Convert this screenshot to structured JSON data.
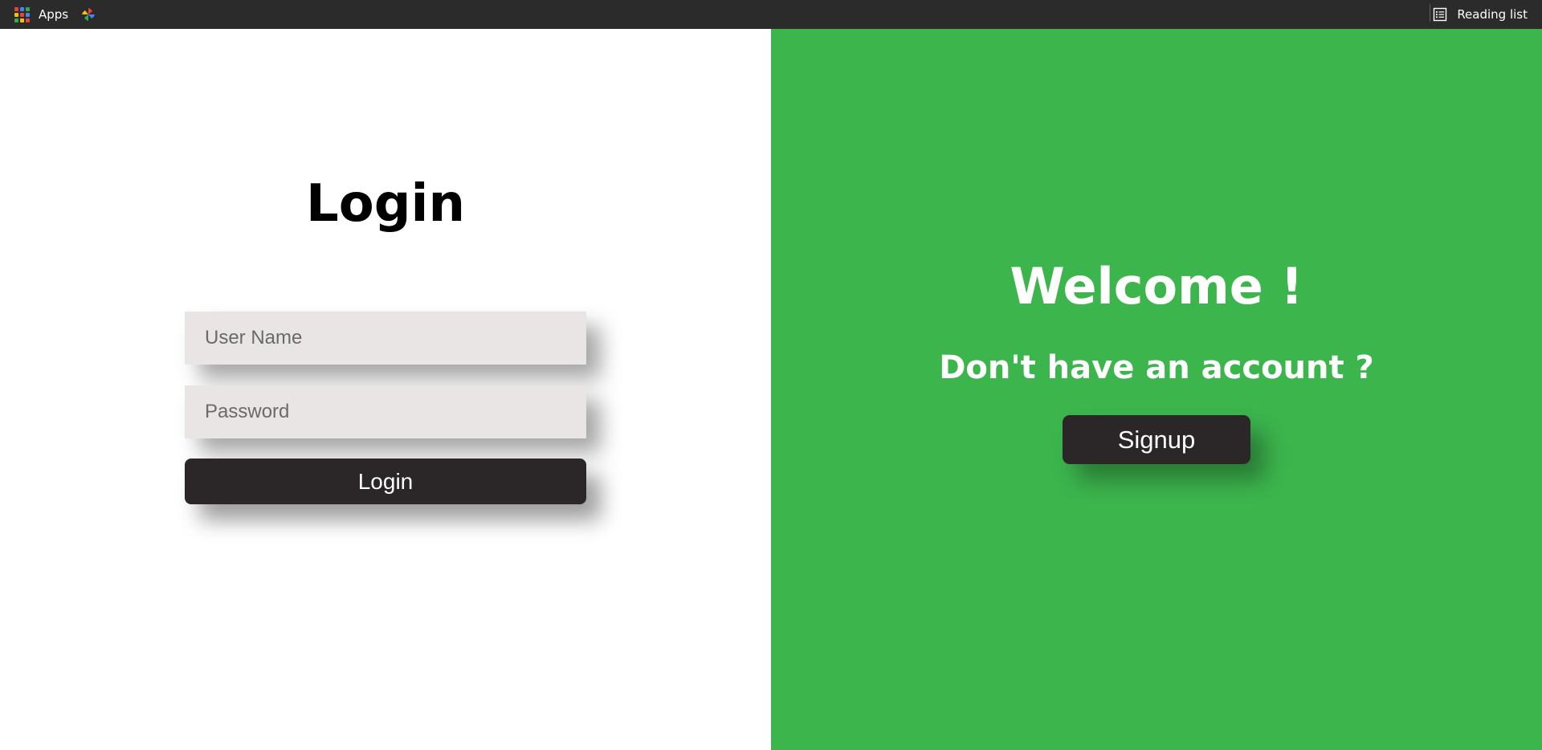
{
  "bookmarks_bar": {
    "apps_label": "Apps",
    "reading_list_label": "Reading list"
  },
  "login_panel": {
    "title": "Login",
    "username_placeholder": "User Name",
    "password_placeholder": "Password",
    "login_button_label": "Login"
  },
  "signup_panel": {
    "welcome_title": "Welcome !",
    "account_prompt": "Don't have an account ?",
    "signup_button_label": "Signup"
  },
  "colors": {
    "bookmarks_bar_bg": "#2b2b2b",
    "accent_green": "#3cb54d",
    "input_bg": "#e9e5e4",
    "button_dark": "#2b2627",
    "apps_grid": [
      "#ea4335",
      "#4285f4",
      "#34a853",
      "#fbbc05",
      "#ea4335",
      "#4285f4",
      "#34a853",
      "#fbbc05",
      "#ea4335"
    ]
  },
  "icons": {
    "apps": "apps-grid-icon",
    "bookmark": "photos-pinwheel-icon",
    "reading_list": "reading-list-icon"
  }
}
